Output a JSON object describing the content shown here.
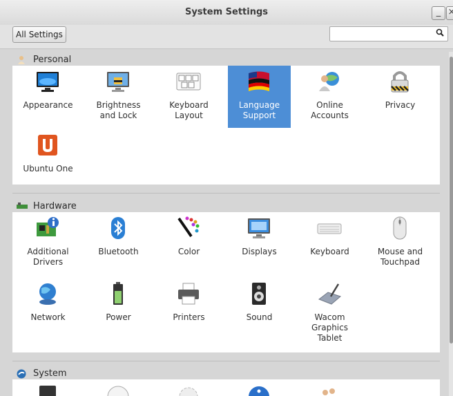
{
  "window": {
    "title": "System Settings",
    "minimize_label": "_",
    "close_label": "×"
  },
  "toolbar": {
    "all_settings_label": "All Settings",
    "search_placeholder": ""
  },
  "sections": {
    "personal": {
      "title": "Personal"
    },
    "hardware": {
      "title": "Hardware"
    },
    "system": {
      "title": "System"
    }
  },
  "personal": {
    "appearance": "Appearance",
    "brightness": "Brightness\nand Lock",
    "keyboard_layout": "Keyboard\nLayout",
    "language": "Language\nSupport",
    "online_accounts": "Online\nAccounts",
    "privacy": "Privacy",
    "ubuntu_one": "Ubuntu One"
  },
  "hardware": {
    "additional_drivers": "Additional\nDrivers",
    "bluetooth": "Bluetooth",
    "color": "Color",
    "displays": "Displays",
    "keyboard": "Keyboard",
    "mouse": "Mouse and\nTouchpad",
    "network": "Network",
    "power": "Power",
    "printers": "Printers",
    "sound": "Sound",
    "wacom": "Wacom\nGraphics\nTablet"
  },
  "colors": {
    "selected": "#4d8ed6",
    "panel": "#ffffff",
    "window": "#d6d6d6"
  }
}
